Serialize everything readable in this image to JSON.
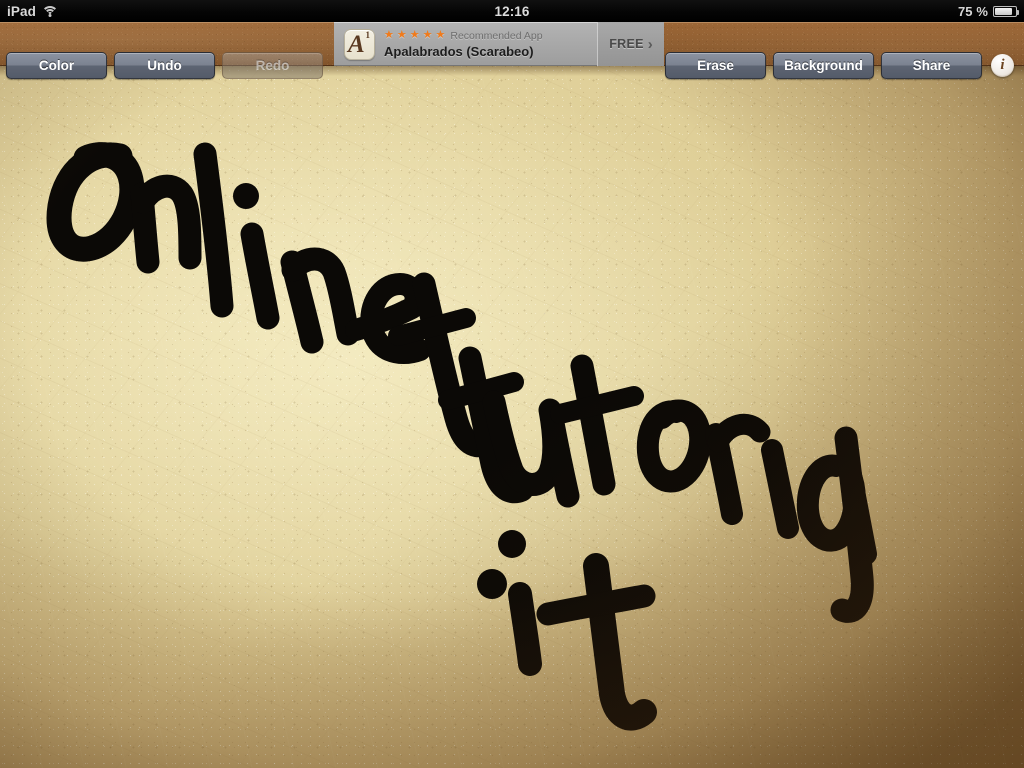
{
  "statusbar": {
    "carrier": "iPad",
    "wifi_icon": "wifi-icon",
    "time": "12:16",
    "battery_pct": "75 %",
    "battery_icon": "battery-icon",
    "battery_level": 75
  },
  "toolbar": {
    "color_label": "Color",
    "undo_label": "Undo",
    "redo_label": "Redo",
    "erase_label": "Erase",
    "background_label": "Background",
    "share_label": "Share",
    "info_glyph": "i",
    "redo_disabled": true
  },
  "ad": {
    "icon_glyph": "A",
    "icon_sup": "1",
    "stars": "★★★★★",
    "star_count": 5,
    "recommended_label": "Recommended App",
    "app_title": "Apalabrados (Scarabeo)",
    "cta_label": "FREE",
    "cta_chevron": "›"
  },
  "canvas": {
    "drawing_text": "Onlinetutorial .it",
    "ink_color": "#0b0906",
    "paper_color": "#dfcf98"
  },
  "colors": {
    "toolbar_brown": "#8d5b2e",
    "button_gray": "#7b8290",
    "ad_gray": "#a8a8a8",
    "star_orange": "#f07a1a",
    "paper_light": "#ece0b0",
    "paper_dark": "#936f3c"
  }
}
